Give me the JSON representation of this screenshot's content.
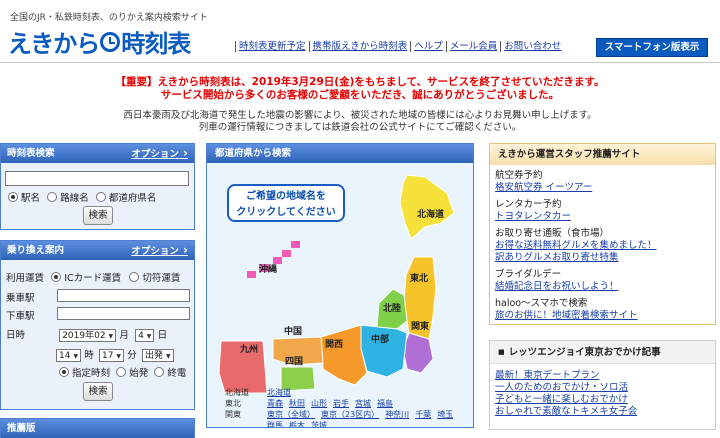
{
  "header": {
    "tagline": "全国のJR・私鉄時刻表、のりかえ案内検索サイト",
    "logo_part1": "えきから",
    "logo_part2": "時刻表",
    "nav": [
      "時刻表更新予定",
      "携帯版えきから時刻表",
      "ヘルプ",
      "メール会員",
      "お問い合わせ"
    ],
    "smartphone_button": "スマートフォン版表示"
  },
  "notice": {
    "line1": "【重要】えきから時刻表は、2019年3月29日(金)をもちまして、サービスを終了させていただきます。",
    "line2": "サービス開始から多くのお客様のご愛顧をいただき、誠にありがとうございました。",
    "info1": "西日本豪雨及び北海道で発生した地震の影響により、被災された地域の皆様には心よりお見舞い申し上げます。",
    "info2": "列車の運行情報につきましては鉄道会社の公式サイトにてご確認ください。"
  },
  "timetable_search": {
    "title": "時刻表検索",
    "option": "オプション",
    "radios": [
      {
        "label": "駅名",
        "checked": true
      },
      {
        "label": "路線名",
        "checked": false
      },
      {
        "label": "都道府県名",
        "checked": false
      }
    ],
    "search_button": "検索"
  },
  "transfer_search": {
    "title": "乗り換え案内",
    "option": "オプション",
    "fare_label": "利用運賃",
    "fare_options": [
      {
        "label": "ICカード運賃",
        "checked": true
      },
      {
        "label": "切符運賃",
        "checked": false
      }
    ],
    "from_label": "乗車駅",
    "to_label": "下車駅",
    "date_label": "日時",
    "year_value": "2019年02",
    "month_unit": "月",
    "day_value": "4",
    "day_unit": "日",
    "hour_value": "14",
    "hour_unit": "時",
    "minute_value": "17",
    "minute_unit": "分",
    "mode_value": "出発",
    "time_types": [
      {
        "label": "指定時刻",
        "checked": true
      },
      {
        "label": "始発",
        "checked": false
      },
      {
        "label": "終電",
        "checked": false
      }
    ],
    "search_button": "検索"
  },
  "third_panel_title": "推薦版",
  "map": {
    "title": "都道府県から検索",
    "bubble_line1": "ご希望の地域名を",
    "bubble_line2": "クリックしてください",
    "regions": [
      "北海道",
      "東北",
      "関東",
      "中部",
      "北陸",
      "関西",
      "中国",
      "四国",
      "九州",
      "沖縄"
    ],
    "pref_rows": [
      {
        "region": "北海道",
        "prefs": [
          "北海道"
        ]
      },
      {
        "region": "東北",
        "prefs": [
          "青森",
          "秋田",
          "山形",
          "岩手",
          "宮城",
          "福島"
        ]
      },
      {
        "region": "関東",
        "prefs": [
          "東京（全域）",
          "東京（23区内）",
          "神奈川",
          "千葉",
          "埼玉"
        ]
      },
      {
        "region": "",
        "prefs": [
          "群馬",
          "栃木",
          "茨城"
        ]
      }
    ]
  },
  "staff_picks": {
    "title": "えきから運営スタッフ推薦サイト",
    "sections": [
      {
        "category": "航空券予約",
        "links": [
          "格安航空券 イーツアー"
        ]
      },
      {
        "category": "レンタカー予約",
        "links": [
          "トヨタレンタカー"
        ]
      },
      {
        "category": "お取り寄せ通販（食市場）",
        "links": [
          "お得な送料無料グルメを集めました！",
          "訳ありグルメお取り寄せ特集"
        ]
      },
      {
        "category": "ブライダルデー",
        "links": [
          "結婚記念日をお祝いしよう！"
        ]
      },
      {
        "category": "haloo～スマホで検索",
        "links": [
          "旅のお供に！地域密着検索サイト"
        ]
      }
    ]
  },
  "lets_enjoy": {
    "title": "レッツエンジョイ東京おでかけ記事",
    "links": [
      "最新！東京デートプラン",
      "一人のためのおでかけ・ソロ活",
      "子どもと一緒に楽しむおでかけ",
      "おしゃれで素敵なトキメキ女子会"
    ]
  },
  "colors": {
    "brand_blue": "#0a5bbf",
    "notice_red": "#e60000",
    "link": "#1a3fa8",
    "map_hokkaido": "#f6e03a",
    "map_tohoku": "#f6c32a",
    "map_kanto": "#b06fd6",
    "map_chubu": "#2fb3e3",
    "map_hokuriku": "#7fd14a",
    "map_kansai": "#f59a2a",
    "map_chugoku": "#f0a84a",
    "map_shikoku": "#8ccf4a",
    "map_kyushu": "#e96a6a",
    "map_okinawa": "#f25ab8"
  }
}
